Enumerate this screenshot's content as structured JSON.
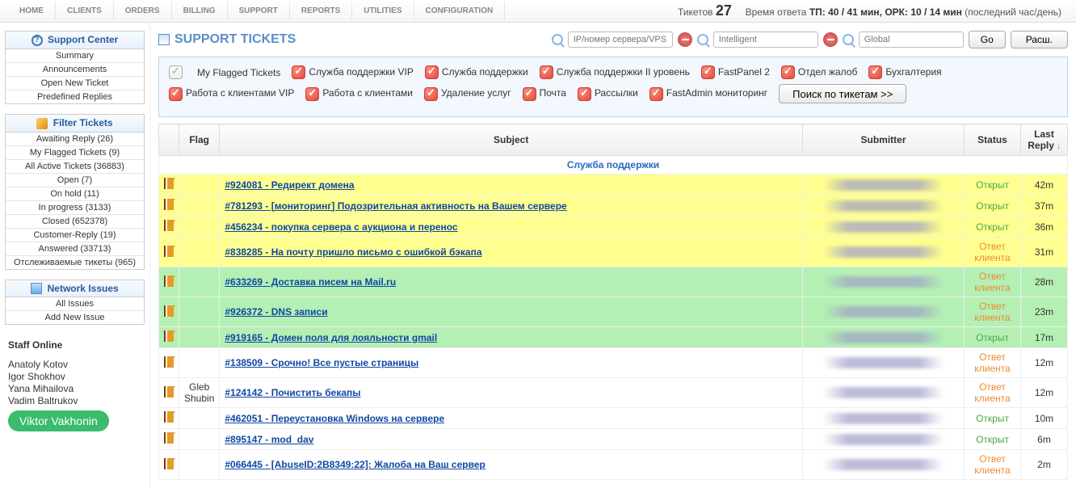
{
  "nav": {
    "tabs": [
      "HOME",
      "CLIENTS",
      "ORDERS",
      "BILLING",
      "SUPPORT",
      "REPORTS",
      "UTILITIES",
      "CONFIGURATION"
    ]
  },
  "header": {
    "tickets_label": "Тикетов",
    "tickets_count": "27",
    "resp_time_label": "Время ответа",
    "tp_label": "ТП:",
    "tp_value": "40 / 41 мин,",
    "ork_label": "ОРК:",
    "ork_value": "10 / 14 мин",
    "suffix": "(последний час/день)"
  },
  "sidebar": {
    "support_center": {
      "title": "Support Center",
      "items": [
        "Summary",
        "Announcements",
        "Open New Ticket",
        "Predefined Replies"
      ]
    },
    "filter_tickets": {
      "title": "Filter Tickets",
      "items": [
        "Awaiting Reply (26)",
        "My Flagged Tickets (9)",
        "All Active Tickets (36883)",
        "Open (7)",
        "On hold (11)",
        "In progress (3133)",
        "Closed (652378)",
        "Customer-Reply (19)",
        "Answered (33713)",
        "Отслеживаемые тикеты (965)"
      ]
    },
    "network_issues": {
      "title": "Network Issues",
      "items": [
        "All Issues",
        "Add New Issue"
      ]
    },
    "staff": {
      "title": "Staff Online",
      "names": [
        "Anatoly Kotov",
        "Igor Shokhov",
        "Yana Mihailova",
        "Vadim Baltrukov"
      ],
      "badge": "Viktor Vakhonin"
    }
  },
  "page": {
    "title": "SUPPORT TICKETS"
  },
  "search": {
    "ph1": "IP/номер сервера/VPS",
    "ph2": "Intelligent",
    "ph3": "Global",
    "go": "Go",
    "ext": "Расш."
  },
  "filters": {
    "row1": [
      "My Flagged Tickets",
      "Служба поддержки VIP",
      "Служба поддержки",
      "Служба поддержки II уровень",
      "FastPanel 2",
      "Отдел жалоб",
      "Бухгалтерия"
    ],
    "row2": [
      "Работа с клиентами VIP",
      "Работа с клиентами",
      "Удаление услуг",
      "Почта",
      "Рассылки",
      "FastAdmin мониторинг"
    ],
    "search_btn": "Поиск по тикетам >>"
  },
  "table": {
    "headers": {
      "flag": "Flag",
      "subject": "Subject",
      "submitter": "Submitter",
      "status": "Status",
      "last_reply": "Last Reply"
    },
    "category": "Служба поддержки",
    "rows": [
      {
        "color": "yellow",
        "flag": "",
        "subject": "#924081 - Редирект домена",
        "status": "Открыт",
        "status_type": "open",
        "last": "42m"
      },
      {
        "color": "yellow",
        "flag": "",
        "subject": "#781293 - [мониторинг] Подозрительная активность на Вашем сервере",
        "status": "Открыт",
        "status_type": "open",
        "last": "37m"
      },
      {
        "color": "yellow",
        "flag": "",
        "subject": "#456234 - покупка сервера с аукциона и перенос",
        "status": "Открыт",
        "status_type": "open",
        "last": "36m"
      },
      {
        "color": "yellow",
        "flag": "",
        "subject": "#838285 - На почту пришло письмо с ошибкой бэкапа",
        "status": "Ответ клиента",
        "status_type": "client",
        "last": "31m"
      },
      {
        "color": "green",
        "flag": "",
        "subject": "#633269 - Доставка писем на Mail.ru",
        "status": "Ответ клиента",
        "status_type": "client",
        "last": "28m"
      },
      {
        "color": "green",
        "flag": "",
        "subject": "#926372 - DNS записи",
        "status": "Ответ клиента",
        "status_type": "client",
        "last": "23m"
      },
      {
        "color": "green",
        "flag": "",
        "subject": "#919165 - Домен поля для лояльности gmail",
        "status": "Открыт",
        "status_type": "open",
        "last": "17m"
      },
      {
        "color": "white",
        "flag": "",
        "subject": "#138509 - Срочно! Все пустые страницы",
        "status": "Ответ клиента",
        "status_type": "client",
        "last": "12m"
      },
      {
        "color": "white",
        "flag": "Gleb Shubin",
        "subject": "#124142 - Почистить бекапы",
        "status": "Ответ клиента",
        "status_type": "client",
        "last": "12m"
      },
      {
        "color": "white",
        "flag": "",
        "subject": "#462051 - Переустановка Windows на сервере",
        "status": "Открыт",
        "status_type": "open",
        "last": "10m"
      },
      {
        "color": "white",
        "flag": "",
        "subject": "#895147 - mod_dav",
        "status": "Открыт",
        "status_type": "open",
        "last": "6m"
      },
      {
        "color": "white",
        "flag": "",
        "subject": "#066445 - [AbuseID:2B8349:22]: Жалоба на Ваш сервер",
        "status": "Ответ клиента",
        "status_type": "client",
        "last": "2m"
      }
    ]
  }
}
